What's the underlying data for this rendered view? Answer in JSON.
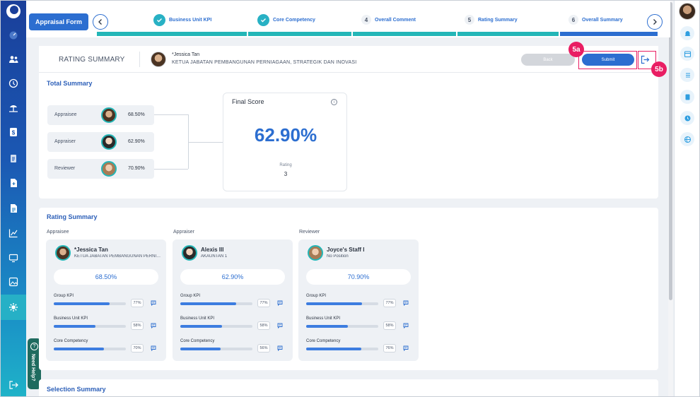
{
  "stepper": {
    "form_label": "Appraisal Form",
    "steps": [
      {
        "label": "Business Unit KPI",
        "state": "done"
      },
      {
        "label": "Core Competency",
        "state": "done"
      },
      {
        "number": "4",
        "label": "Overall Comment",
        "state": "pending"
      },
      {
        "number": "5",
        "label": "Rating Summary",
        "state": "pending"
      },
      {
        "number": "6",
        "label": "Overall Summary",
        "state": "current"
      }
    ]
  },
  "header": {
    "section_label": "RATING SUMMARY",
    "employee_name": "*Jessica Tan",
    "employee_position": "KETUA JABATAN PEMBANGUNAN PERNIAGAAN, STRATEGIK DAN INOVASI",
    "back_label": "Back",
    "submit_label": "Submit",
    "annotation_submit": "5a",
    "annotation_exit": "5b"
  },
  "total_summary": {
    "title": "Total Summary",
    "rows": [
      {
        "label": "Appraisee",
        "value": "68.50%"
      },
      {
        "label": "Appraiser",
        "value": "62.90%"
      },
      {
        "label": "Reviewer",
        "value": "70.90%"
      }
    ],
    "final_score_label": "Final Score",
    "final_score_value": "62.90%",
    "rating_label": "Rating",
    "rating_value": "3"
  },
  "rating_summary": {
    "title": "Rating Summary",
    "cards": [
      {
        "role": "Appraisee",
        "name": "*Jessica Tan",
        "position": "KETUA JABATAN PEMBANGUNAN PERNIAGAAN, STRATEGIK DAN INOVASI",
        "score": "68.50%",
        "metrics": [
          {
            "label": "Group KPI",
            "pct": "77%",
            "fill": 0.77
          },
          {
            "label": "Business Unit KPI",
            "pct": "58%",
            "fill": 0.58
          },
          {
            "label": "Core Competency",
            "pct": "70%",
            "fill": 0.7
          }
        ]
      },
      {
        "role": "Appraiser",
        "name": "Alexis III",
        "position": "AKAUNTAN 1",
        "score": "62.90%",
        "metrics": [
          {
            "label": "Group KPI",
            "pct": "77%",
            "fill": 0.77
          },
          {
            "label": "Business Unit KPI",
            "pct": "58%",
            "fill": 0.58
          },
          {
            "label": "Core Competency",
            "pct": "56%",
            "fill": 0.56
          }
        ]
      },
      {
        "role": "Reviewer",
        "name": "Joyce's Staff I",
        "position": "No Position",
        "score": "70.90%",
        "metrics": [
          {
            "label": "Group KPI",
            "pct": "77%",
            "fill": 0.77
          },
          {
            "label": "Business Unit KPI",
            "pct": "58%",
            "fill": 0.58
          },
          {
            "label": "Core Competency",
            "pct": "76%",
            "fill": 0.76
          }
        ]
      }
    ]
  },
  "selection_summary": {
    "title": "Selection Summary"
  },
  "help": {
    "label": "Need Help?"
  },
  "colors": {
    "primary": "#2c6ed0",
    "teal": "#23b6b7",
    "annotation": "#e91e63"
  }
}
